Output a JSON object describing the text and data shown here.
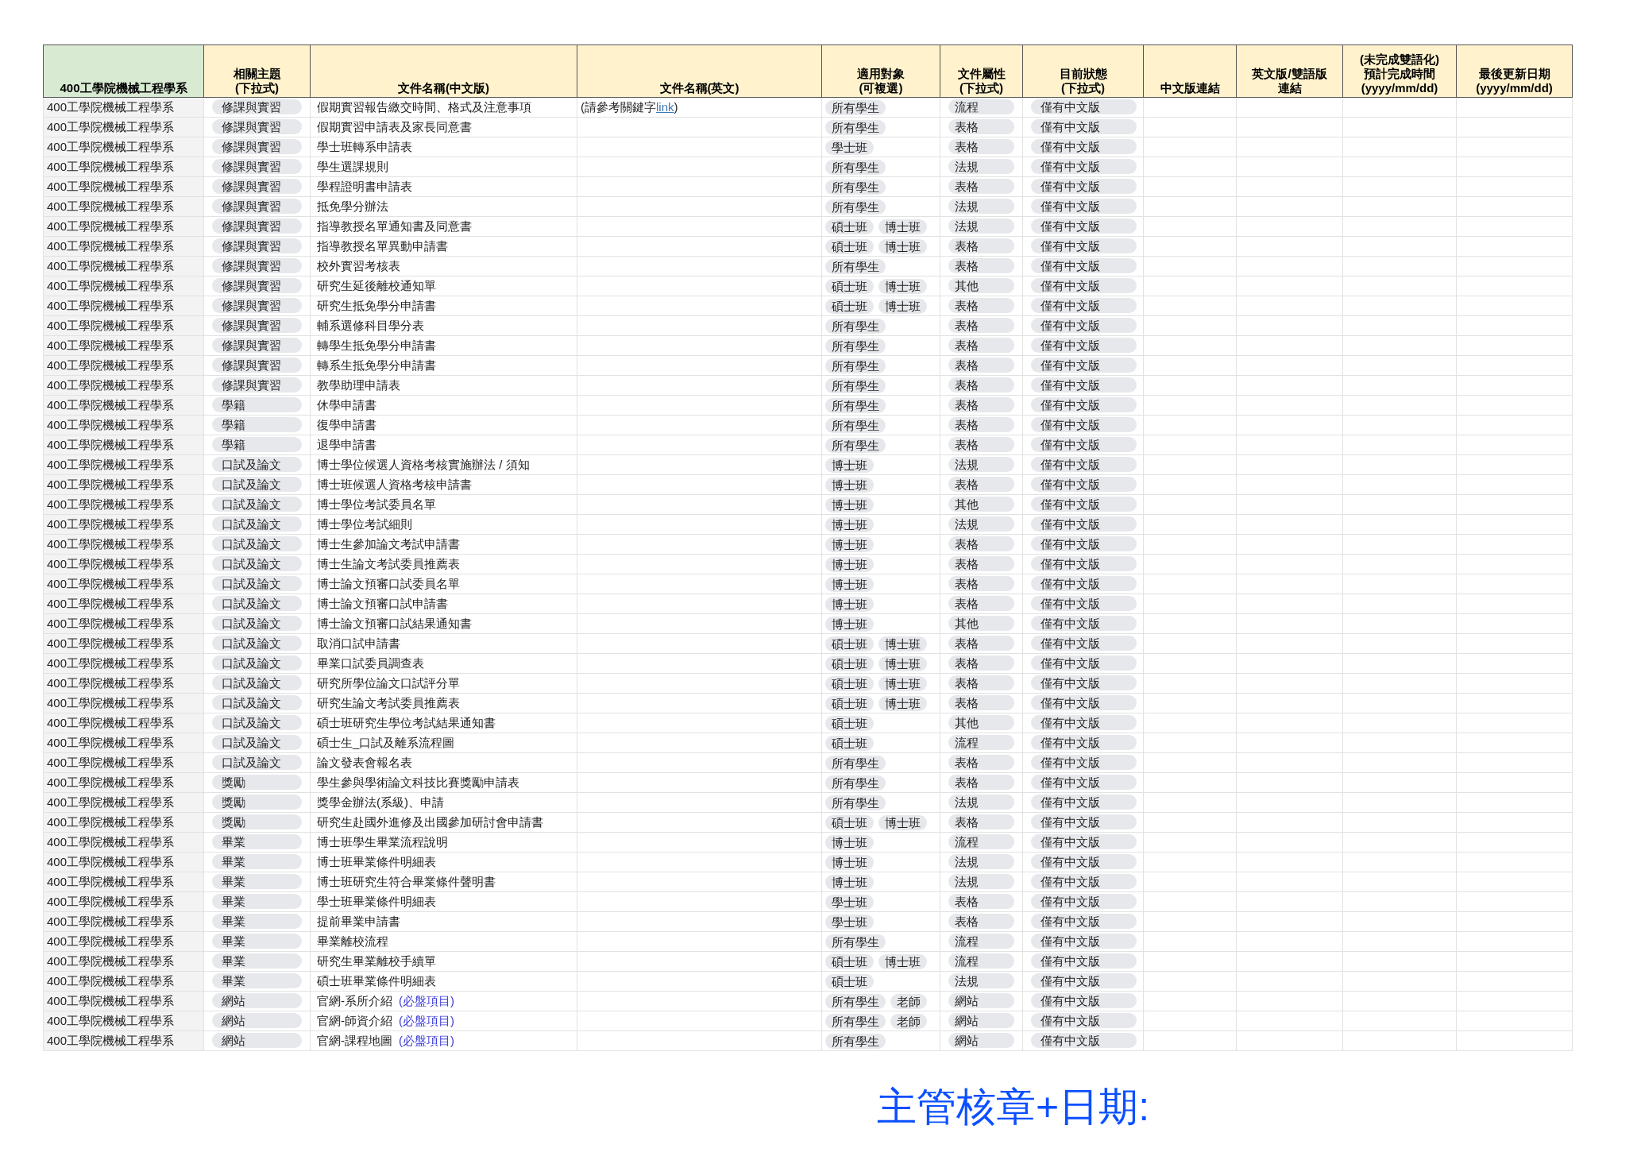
{
  "table": {
    "columns": [
      {
        "lines": [
          "400工學院機械工程學系"
        ],
        "kind": "dept"
      },
      {
        "lines": [
          "相關主題",
          "(下拉式)"
        ],
        "kind": "plain"
      },
      {
        "lines": [
          "文件名稱(中文版)"
        ],
        "kind": "plain"
      },
      {
        "lines": [
          "文件名稱(英文)"
        ],
        "kind": "plain"
      },
      {
        "lines": [
          "適用對象",
          "(可複選)"
        ],
        "kind": "plain"
      },
      {
        "lines": [
          "文件屬性",
          "(下拉式)"
        ],
        "kind": "plain"
      },
      {
        "lines": [
          "目前狀態",
          "(下拉式)"
        ],
        "kind": "plain"
      },
      {
        "lines": [
          "中文版連結"
        ],
        "kind": "plain"
      },
      {
        "lines": [
          "英文版/雙語版",
          "連結"
        ],
        "kind": "plain"
      },
      {
        "lines": [
          "(未完成雙語化)",
          "預計完成時間",
          "(yyyy/mm/dd)"
        ],
        "kind": "plain"
      },
      {
        "lines": [
          "最後更新日期",
          "(yyyy/mm/dd)"
        ],
        "kind": "plain"
      }
    ],
    "rows": [
      {
        "dept": "400工學院機械工程學系",
        "topic": "修課與實習",
        "name": "假期實習報告繳交時間、格式及注意事項",
        "name_en": [
          {
            "kind": "text",
            "text": "(請參考關鍵字"
          },
          {
            "kind": "link",
            "text": "link"
          },
          {
            "kind": "text",
            "text": ")"
          }
        ],
        "audience": [
          "所有學生"
        ],
        "type": "流程",
        "status": "僅有中文版"
      },
      {
        "dept": "400工學院機械工程學系",
        "topic": "修課與實習",
        "name": "假期實習申請表及家長同意書",
        "audience": [
          "所有學生"
        ],
        "type": "表格",
        "status": "僅有中文版"
      },
      {
        "dept": "400工學院機械工程學系",
        "topic": "修課與實習",
        "name": "學士班轉系申請表",
        "audience": [
          "學士班"
        ],
        "type": "表格",
        "status": "僅有中文版"
      },
      {
        "dept": "400工學院機械工程學系",
        "topic": "修課與實習",
        "name": "學生選課規則",
        "audience": [
          "所有學生"
        ],
        "type": "法規",
        "status": "僅有中文版"
      },
      {
        "dept": "400工學院機械工程學系",
        "topic": "修課與實習",
        "name": "學程證明書申請表",
        "audience": [
          "所有學生"
        ],
        "type": "表格",
        "status": "僅有中文版"
      },
      {
        "dept": "400工學院機械工程學系",
        "topic": "修課與實習",
        "name": "抵免學分辦法",
        "audience": [
          "所有學生"
        ],
        "type": "法規",
        "status": "僅有中文版"
      },
      {
        "dept": "400工學院機械工程學系",
        "topic": "修課與實習",
        "name": "指導教授名單通知書及同意書",
        "audience": [
          "碩士班",
          "博士班"
        ],
        "type": "法規",
        "status": "僅有中文版"
      },
      {
        "dept": "400工學院機械工程學系",
        "topic": "修課與實習",
        "name": "指導教授名單異動申請書",
        "audience": [
          "碩士班",
          "博士班"
        ],
        "type": "表格",
        "status": "僅有中文版"
      },
      {
        "dept": "400工學院機械工程學系",
        "topic": "修課與實習",
        "name": "校外實習考核表",
        "audience": [
          "所有學生"
        ],
        "type": "表格",
        "status": "僅有中文版"
      },
      {
        "dept": "400工學院機械工程學系",
        "topic": "修課與實習",
        "name": "研究生延後離校通知單",
        "audience": [
          "碩士班",
          "博士班"
        ],
        "type": "其他",
        "status": "僅有中文版"
      },
      {
        "dept": "400工學院機械工程學系",
        "topic": "修課與實習",
        "name": "研究生抵免學分申請書",
        "audience": [
          "碩士班",
          "博士班"
        ],
        "type": "表格",
        "status": "僅有中文版"
      },
      {
        "dept": "400工學院機械工程學系",
        "topic": "修課與實習",
        "name": "輔系選修科目學分表",
        "audience": [
          "所有學生"
        ],
        "type": "表格",
        "status": "僅有中文版"
      },
      {
        "dept": "400工學院機械工程學系",
        "topic": "修課與實習",
        "name": "轉學生抵免學分申請書",
        "audience": [
          "所有學生"
        ],
        "type": "表格",
        "status": "僅有中文版"
      },
      {
        "dept": "400工學院機械工程學系",
        "topic": "修課與實習",
        "name": "轉系生抵免學分申請書",
        "audience": [
          "所有學生"
        ],
        "type": "表格",
        "status": "僅有中文版"
      },
      {
        "dept": "400工學院機械工程學系",
        "topic": "修課與實習",
        "name": "教學助理申請表",
        "audience": [
          "所有學生"
        ],
        "type": "表格",
        "status": "僅有中文版"
      },
      {
        "dept": "400工學院機械工程學系",
        "topic": "學籍",
        "name": "休學申請書",
        "audience": [
          "所有學生"
        ],
        "type": "表格",
        "status": "僅有中文版"
      },
      {
        "dept": "400工學院機械工程學系",
        "topic": "學籍",
        "name": "復學申請書",
        "audience": [
          "所有學生"
        ],
        "type": "表格",
        "status": "僅有中文版"
      },
      {
        "dept": "400工學院機械工程學系",
        "topic": "學籍",
        "name": "退學申請書",
        "audience": [
          "所有學生"
        ],
        "type": "表格",
        "status": "僅有中文版"
      },
      {
        "dept": "400工學院機械工程學系",
        "topic": "口試及論文",
        "name": "博士學位候選人資格考核實施辦法 / 須知",
        "audience": [
          "博士班"
        ],
        "type": "法規",
        "status": "僅有中文版"
      },
      {
        "dept": "400工學院機械工程學系",
        "topic": "口試及論文",
        "name": "博士班候選人資格考核申請書",
        "audience": [
          "博士班"
        ],
        "type": "表格",
        "status": "僅有中文版"
      },
      {
        "dept": "400工學院機械工程學系",
        "topic": "口試及論文",
        "name": "博士學位考試委員名單",
        "audience": [
          "博士班"
        ],
        "type": "其他",
        "status": "僅有中文版"
      },
      {
        "dept": "400工學院機械工程學系",
        "topic": "口試及論文",
        "name": "博士學位考試細則",
        "audience": [
          "博士班"
        ],
        "type": "法規",
        "status": "僅有中文版"
      },
      {
        "dept": "400工學院機械工程學系",
        "topic": "口試及論文",
        "name": "博士生參加論文考試申請書",
        "audience": [
          "博士班"
        ],
        "type": "表格",
        "status": "僅有中文版"
      },
      {
        "dept": "400工學院機械工程學系",
        "topic": "口試及論文",
        "name": "博士生論文考試委員推薦表",
        "audience": [
          "博士班"
        ],
        "type": "表格",
        "status": "僅有中文版"
      },
      {
        "dept": "400工學院機械工程學系",
        "topic": "口試及論文",
        "name": "博士論文預審口試委員名單",
        "audience": [
          "博士班"
        ],
        "type": "表格",
        "status": "僅有中文版"
      },
      {
        "dept": "400工學院機械工程學系",
        "topic": "口試及論文",
        "name": "博士論文預審口試申請書",
        "audience": [
          "博士班"
        ],
        "type": "表格",
        "status": "僅有中文版"
      },
      {
        "dept": "400工學院機械工程學系",
        "topic": "口試及論文",
        "name": "博士論文預審口試結果通知書",
        "audience": [
          "博士班"
        ],
        "type": "其他",
        "status": "僅有中文版"
      },
      {
        "dept": "400工學院機械工程學系",
        "topic": "口試及論文",
        "name": "取消口試申請書",
        "audience": [
          "碩士班",
          "博士班"
        ],
        "type": "表格",
        "status": "僅有中文版"
      },
      {
        "dept": "400工學院機械工程學系",
        "topic": "口試及論文",
        "name": "畢業口試委員調查表",
        "audience": [
          "碩士班",
          "博士班"
        ],
        "type": "表格",
        "status": "僅有中文版"
      },
      {
        "dept": "400工學院機械工程學系",
        "topic": "口試及論文",
        "name": "研究所學位論文口試評分單",
        "audience": [
          "碩士班",
          "博士班"
        ],
        "type": "表格",
        "status": "僅有中文版"
      },
      {
        "dept": "400工學院機械工程學系",
        "topic": "口試及論文",
        "name": "研究生論文考試委員推薦表",
        "audience": [
          "碩士班",
          "博士班"
        ],
        "type": "表格",
        "status": "僅有中文版"
      },
      {
        "dept": "400工學院機械工程學系",
        "topic": "口試及論文",
        "name": "碩士班研究生學位考試結果通知書",
        "audience": [
          "碩士班"
        ],
        "type": "其他",
        "status": "僅有中文版"
      },
      {
        "dept": "400工學院機械工程學系",
        "topic": "口試及論文",
        "name": "碩士生_口試及離系流程圖",
        "audience": [
          "碩士班"
        ],
        "type": "流程",
        "status": "僅有中文版"
      },
      {
        "dept": "400工學院機械工程學系",
        "topic": "口試及論文",
        "name": "論文發表會報名表",
        "audience": [
          "所有學生"
        ],
        "type": "表格",
        "status": "僅有中文版"
      },
      {
        "dept": "400工學院機械工程學系",
        "topic": "獎勵",
        "name": "學生參與學術論文科技比賽獎勵申請表",
        "audience": [
          "所有學生"
        ],
        "type": "表格",
        "status": "僅有中文版"
      },
      {
        "dept": "400工學院機械工程學系",
        "topic": "獎勵",
        "name": "獎學金辦法(系級)、申請",
        "audience": [
          "所有學生"
        ],
        "type": "法規",
        "status": "僅有中文版"
      },
      {
        "dept": "400工學院機械工程學系",
        "topic": "獎勵",
        "name": "研究生赴國外進修及出國參加研討會申請書",
        "audience": [
          "碩士班",
          "博士班"
        ],
        "type": "表格",
        "status": "僅有中文版"
      },
      {
        "dept": "400工學院機械工程學系",
        "topic": "畢業",
        "name": "博士班學生畢業流程說明",
        "audience": [
          "博士班"
        ],
        "type": "流程",
        "status": "僅有中文版"
      },
      {
        "dept": "400工學院機械工程學系",
        "topic": "畢業",
        "name": "博士班畢業條件明細表",
        "audience": [
          "博士班"
        ],
        "type": "法規",
        "status": "僅有中文版"
      },
      {
        "dept": "400工學院機械工程學系",
        "topic": "畢業",
        "name": "博士班研究生符合畢業條件聲明書",
        "audience": [
          "博士班"
        ],
        "type": "法規",
        "status": "僅有中文版"
      },
      {
        "dept": "400工學院機械工程學系",
        "topic": "畢業",
        "name": "學士班畢業條件明細表",
        "audience": [
          "學士班"
        ],
        "type": "表格",
        "status": "僅有中文版"
      },
      {
        "dept": "400工學院機械工程學系",
        "topic": "畢業",
        "name": "提前畢業申請書",
        "audience": [
          "學士班"
        ],
        "type": "表格",
        "status": "僅有中文版"
      },
      {
        "dept": "400工學院機械工程學系",
        "topic": "畢業",
        "name": "畢業離校流程",
        "audience": [
          "所有學生"
        ],
        "type": "流程",
        "status": "僅有中文版"
      },
      {
        "dept": "400工學院機械工程學系",
        "topic": "畢業",
        "name": "研究生畢業離校手續單",
        "audience": [
          "碩士班",
          "博士班"
        ],
        "type": "流程",
        "status": "僅有中文版"
      },
      {
        "dept": "400工學院機械工程學系",
        "topic": "畢業",
        "name": "碩士班畢業條件明細表",
        "audience": [
          "碩士班"
        ],
        "type": "法規",
        "status": "僅有中文版"
      },
      {
        "dept": "400工學院機械工程學系",
        "topic": "網站",
        "name": "官網-系所介紹",
        "note": "(必盤項目)",
        "audience": [
          "所有學生",
          "老師"
        ],
        "type": "網站",
        "status": "僅有中文版"
      },
      {
        "dept": "400工學院機械工程學系",
        "topic": "網站",
        "name": "官網-師資介紹",
        "note": "(必盤項目)",
        "audience": [
          "所有學生",
          "老師"
        ],
        "type": "網站",
        "status": "僅有中文版"
      },
      {
        "dept": "400工學院機械工程學系",
        "topic": "網站",
        "name": "官網-課程地圖",
        "note": "(必盤項目)",
        "audience": [
          "所有學生"
        ],
        "type": "網站",
        "status": "僅有中文版"
      }
    ]
  },
  "signature_label": "主管核章+日期:"
}
